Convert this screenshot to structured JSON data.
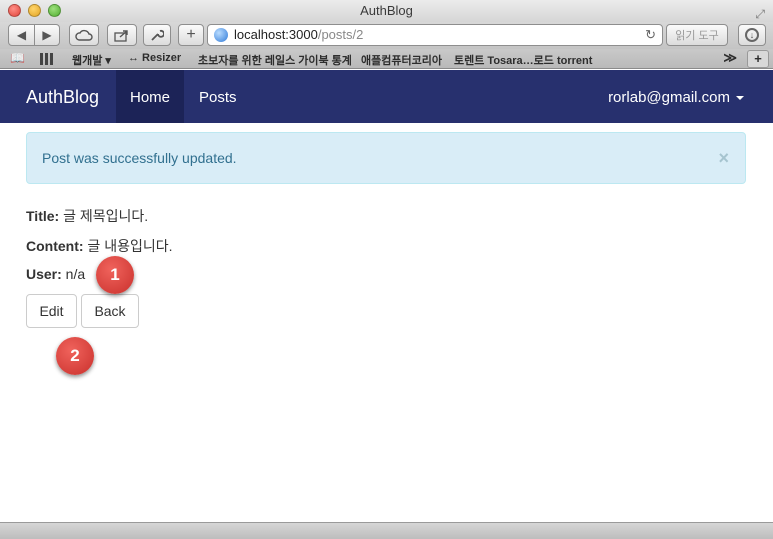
{
  "window": {
    "title": "AuthBlog"
  },
  "toolbar": {
    "url_host": "localhost:3000",
    "url_path": "/posts/2",
    "reader_label": "읽기 도구",
    "plus_label": "+",
    "reload_glyph": "↻"
  },
  "bookmarks": {
    "items": [
      {
        "label": "웹개발 ▾"
      },
      {
        "label": "↔ Resizer"
      },
      {
        "label": "초보자를 위한 레일스 가이북 통계"
      },
      {
        "label": "애플컴퓨터코리아"
      },
      {
        "label": "토렌트 Tosara…로드 torrent"
      }
    ],
    "more_label": "≫",
    "add_label": "+"
  },
  "navbar": {
    "brand": "AuthBlog",
    "home": "Home",
    "posts": "Posts",
    "user": "rorlab@gmail.com"
  },
  "alert": {
    "message": "Post was successfully updated.",
    "close": "×",
    "colors": {
      "background": "#d9edf7",
      "text": "#31708f"
    }
  },
  "post": {
    "title_label": "Title:",
    "title_value": " 글 제목입니다.",
    "content_label": "Content:",
    "content_value": " 글 내용입니다.",
    "user_label": "User:",
    "user_value": " n/a"
  },
  "actions": {
    "edit": "Edit",
    "back": "Back"
  },
  "markers": {
    "one": "1",
    "two": "2"
  },
  "colors": {
    "navbar": "#27306e",
    "nav_active": "#1c2357",
    "marker": "#d9403a"
  }
}
